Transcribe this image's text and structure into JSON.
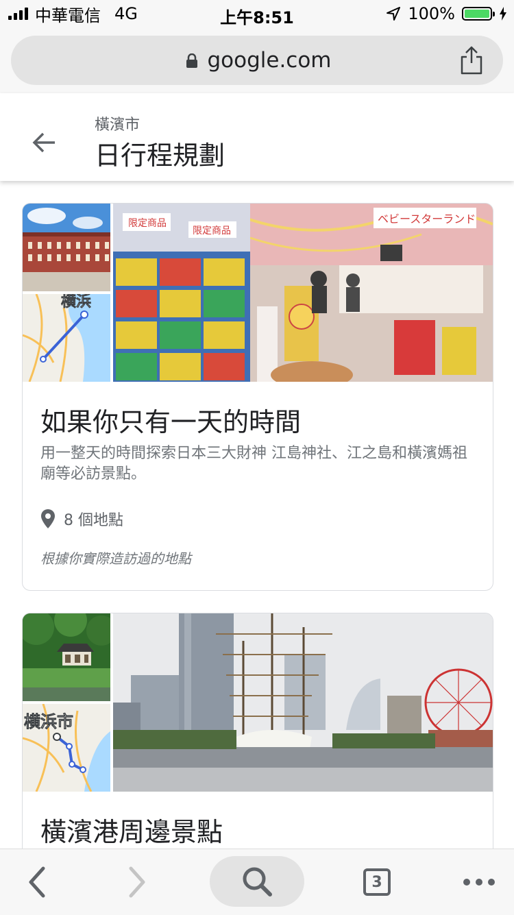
{
  "status_bar": {
    "carrier": "中華電信",
    "network": "4G",
    "time": "上午8:51",
    "battery": "100%",
    "battery_level": 1.0
  },
  "url_bar": {
    "domain": "google.com"
  },
  "header": {
    "subtitle": "橫濱市",
    "title": "日行程規劃"
  },
  "cards": [
    {
      "title": "如果你只有一天的時間",
      "description": "用一整天的時間探索日本三大財神 江島神社、江之島和橫濱媽祖廟等必訪景點。",
      "places": "8 個地點",
      "basis": "根據你實際造訪過的地點",
      "map_label": "横浜",
      "photo_signs": [
        "限定商品",
        "限定商品",
        "ベビースターランド"
      ]
    },
    {
      "title": "橫濱港周邊景點",
      "map_label": "横浜市"
    }
  ],
  "toolbar": {
    "tabs_count": "3"
  },
  "colors": {
    "accent": "#1a73e8",
    "text_primary": "#202124",
    "text_secondary": "#70757a",
    "battery_green": "#4cd964",
    "route_blue": "#3b63d6"
  }
}
